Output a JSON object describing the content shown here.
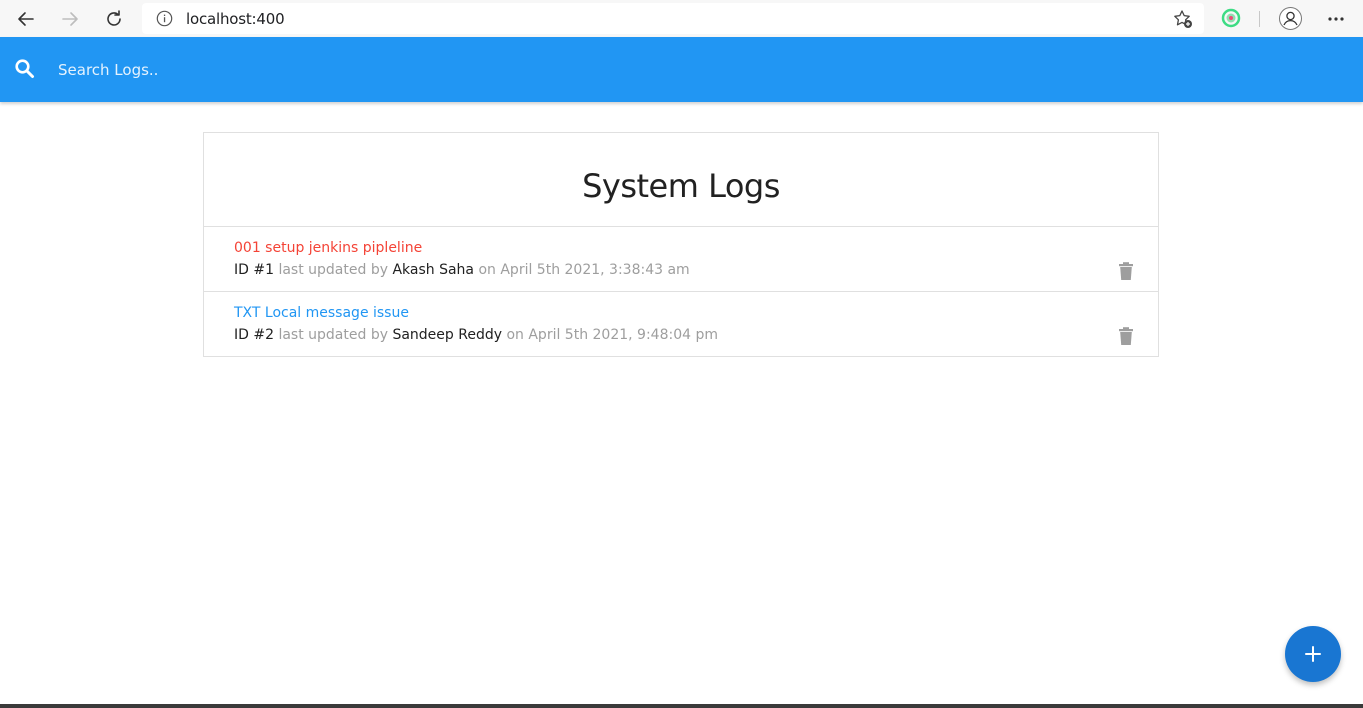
{
  "browser": {
    "url": "localhost:400",
    "icons": [
      "back-icon",
      "forward-icon",
      "reload-icon",
      "info-icon",
      "favorite-add-icon",
      "extension-icon",
      "profile-icon",
      "more-icon"
    ]
  },
  "search": {
    "placeholder": "Search Logs..",
    "icon": "search-icon",
    "bar_color": "#2196f3"
  },
  "page": {
    "title": "System Logs"
  },
  "logs": [
    {
      "message": "001 setup jenkins pipleline",
      "message_color": "#f44336",
      "id_label": "ID #1",
      "updated_by_text": "last updated by",
      "tech": "Akash Saha",
      "date_text": "on April 5th 2021, 3:38:43 am"
    },
    {
      "message": "TXT Local message issue",
      "message_color": "#2196f3",
      "id_label": "ID #2",
      "updated_by_text": "last updated by",
      "tech": "Sandeep Reddy",
      "date_text": "on April 5th 2021, 9:48:04 pm"
    }
  ],
  "fab": {
    "icon": "add-icon",
    "color": "#1976d2"
  }
}
